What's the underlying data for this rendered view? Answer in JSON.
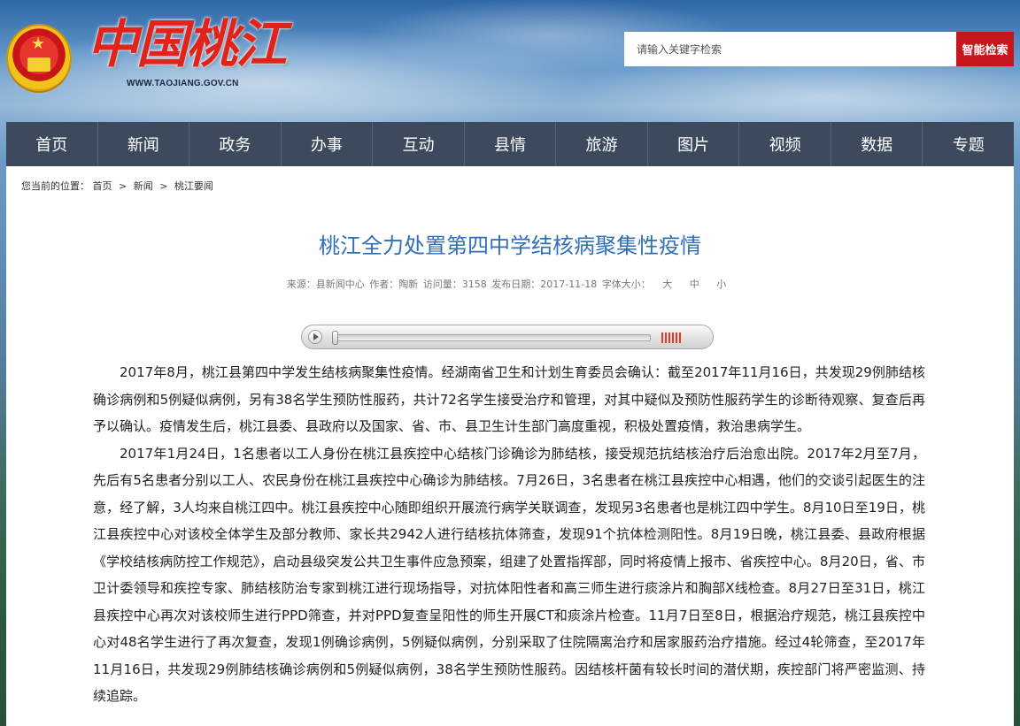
{
  "header": {
    "logo_title": "中国桃江",
    "logo_url": "WWW.TAOJIANG.GOV.CN",
    "search": {
      "placeholder": "请输入关键字检索",
      "button_label": "智能检索"
    }
  },
  "nav": {
    "items": [
      "首页",
      "新闻",
      "政务",
      "办事",
      "互动",
      "县情",
      "旅游",
      "图片",
      "视频",
      "数据",
      "专题"
    ]
  },
  "breadcrumb": {
    "prefix": "您当前的位置：",
    "items": [
      "首页",
      "新闻",
      "桃江要闻"
    ],
    "separator": ">"
  },
  "article": {
    "title": "桃江全力处置第四中学结核病聚集性疫情",
    "meta": {
      "source": "来源：县新闻中心",
      "author": "作者：陶新",
      "views": "访问量：3158",
      "date": "发布日期：2017-11-18",
      "font_size_label": "字体大小：",
      "font_sizes": [
        "大",
        "中",
        "小"
      ]
    },
    "paragraphs": [
      "2017年8月，桃江县第四中学发生结核病聚集性疫情。经湖南省卫生和计划生育委员会确认：截至2017年11月16日，共发现29例肺结核确诊病例和5例疑似病例，另有38名学生预防性服药，共计72名学生接受治疗和管理，对其中疑似及预防性服药学生的诊断待观察、复查后再予以确认。疫情发生后，桃江县委、县政府以及国家、省、市、县卫生计生部门高度重视，积极处置疫情，救治患病学生。",
      "2017年1月24日，1名患者以工人身份在桃江县疾控中心结核门诊确诊为肺结核，接受规范抗结核治疗后治愈出院。2017年2月至7月，先后有5名患者分别以工人、农民身份在桃江县疾控中心确诊为肺结核。7月26日，3名患者在桃江县疾控中心相遇，他们的交谈引起医生的注意，经了解，3人均来自桃江四中。桃江县疾控中心随即组织开展流行病学关联调查，发现另3名患者也是桃江四中学生。8月10日至19日，桃江县疾控中心对该校全体学生及部分教师、家长共2942人进行结核抗体筛查，发现91个抗体检测阳性。8月19日晚，桃江县委、县政府根据《学校结核病防控工作规范》，启动县级突发公共卫生事件应急预案，组建了处置指挥部，同时将疫情上报市、省疾控中心。8月20日，省、市卫计委领导和疾控专家、肺结核防治专家到桃江进行现场指导，对抗体阳性者和高三师生进行痰涂片和胸部X线检查。8月27日至31日，桃江县疾控中心再次对该校师生进行PPD筛查，并对PPD复查呈阳性的师生开展CT和痰涂片检查。11月7日至8日，根据治疗规范，桃江县疾控中心对48名学生进行了再次复查，发现1例确诊病例，5例疑似病例，分别采取了住院隔离治疗和居家服药治疗措施。经过4轮筛查，至2017年11月16日，共发现29例肺结核确诊病例和5例疑似病例，38名学生预防性服药。因结核杆菌有较长时间的潜伏期，疾控部门将严密监测、持续追踪。"
    ]
  },
  "player": {
    "progress": 0,
    "volume_bars": 6
  },
  "colors": {
    "nav_bg": "#3d4a5e",
    "search_button": "#c4161c",
    "title_blue": "#2e6fb7",
    "logo_red": "#e0241b"
  },
  "icons": [
    "national-emblem-icon",
    "play-icon",
    "volume-icon"
  ]
}
